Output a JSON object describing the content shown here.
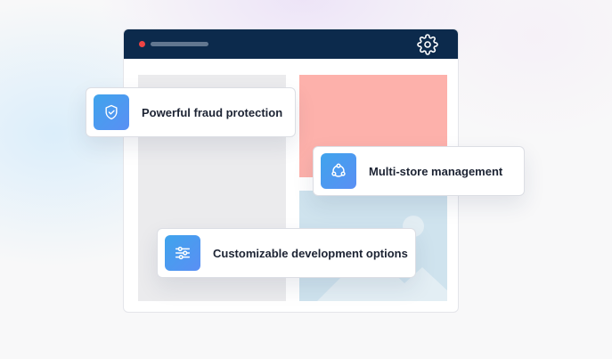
{
  "colors": {
    "titlebar": "#0c2a4c",
    "close_dot": "#ef4444",
    "title_pill": "#a9b6c8",
    "pink_panel": "#fdb1ab",
    "image_panel": "#cfe3ee",
    "image_shape": "#e3eef4",
    "icon_gradient_start": "#3fa4ec",
    "icon_gradient_end": "#5a8ff4"
  },
  "window": {
    "settings_icon": "gear-icon"
  },
  "features": [
    {
      "label": "Powerful fraud protection",
      "icon": "shield-check-icon"
    },
    {
      "label": "Multi-store management",
      "icon": "network-icon"
    },
    {
      "label": "Customizable development options",
      "icon": "sliders-icon"
    }
  ]
}
